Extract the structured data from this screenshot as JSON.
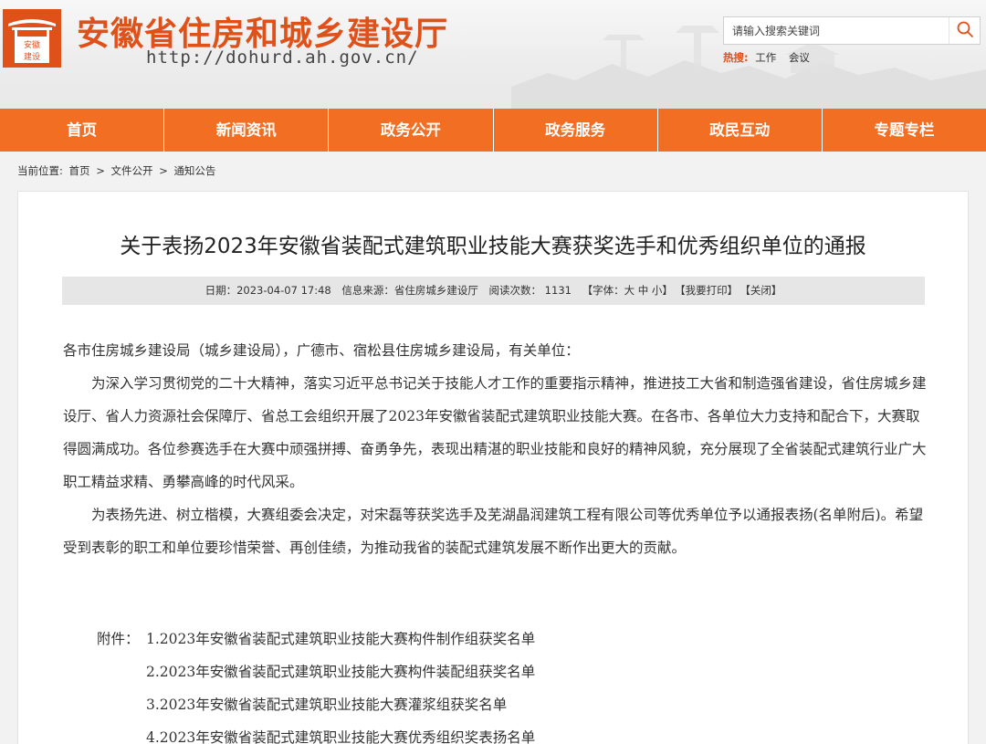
{
  "header": {
    "logo_text": "安徽建设",
    "site_title": "安徽省住房和城乡建设厅",
    "site_url": "http://dohurd.ah.gov.cn/",
    "search_placeholder": "请输入搜索关键词",
    "hot_label": "热搜:",
    "hot_links": [
      "工作",
      "会议"
    ]
  },
  "nav": [
    "首页",
    "新闻资讯",
    "政务公开",
    "政务服务",
    "政民互动",
    "专题专栏"
  ],
  "breadcrumb": {
    "prefix": "当前位置:",
    "items": [
      "首页",
      "文件公开",
      "通知公告"
    ],
    "separator": ">"
  },
  "article": {
    "title": "关于表扬2023年安徽省装配式建筑职业技能大赛获奖选手和优秀组织单位的通报",
    "meta": {
      "date": "日期：2023-04-07 17:48",
      "source": "信息来源：省住房城乡建设厅",
      "views": "阅读次数：  1131",
      "font": "【字体：大 中 小】",
      "print": "【我要打印】",
      "close": "【关闭】"
    },
    "greeting": "各市住房城乡建设局（城乡建设局），广德市、宿松县住房城乡建设局，有关单位：",
    "paragraphs": [
      "为深入学习贯彻党的二十大精神，落实习近平总书记关于技能人才工作的重要指示精神，推进技工大省和制造强省建设，省住房城乡建设厅、省人力资源社会保障厅、省总工会组织开展了2023年安徽省装配式建筑职业技能大赛。在各市、各单位大力支持和配合下，大赛取得圆满成功。各位参赛选手在大赛中顽强拼搏、奋勇争先，表现出精湛的职业技能和良好的精神风貌，充分展现了全省装配式建筑行业广大职工精益求精、勇攀高峰的时代风采。",
      "为表扬先进、树立楷模，大赛组委会决定，对宋磊等获奖选手及芜湖晶润建筑工程有限公司等优秀单位予以通报表扬(名单附后)。希望受到表彰的职工和单位要珍惜荣誉、再创佳绩，为推动我省的装配式建筑发展不断作出更大的贡献。"
    ],
    "attachments_label": "附件：",
    "attachments": [
      "1.2023年安徽省装配式建筑职业技能大赛构件制作组获奖名单",
      "2.2023年安徽省装配式建筑职业技能大赛构件装配组获奖名单",
      "3.2023年安徽省装配式建筑职业技能大赛灌浆组获奖名单",
      "4.2023年安徽省装配式建筑职业技能大赛优秀组织奖表扬名单"
    ]
  },
  "colors": {
    "brand": "#e0511a",
    "nav_bg": "#f26e22",
    "meta_bg": "#e6e6e6"
  },
  "icons": {
    "search": "search-icon",
    "logo": "ahjs-logo"
  }
}
